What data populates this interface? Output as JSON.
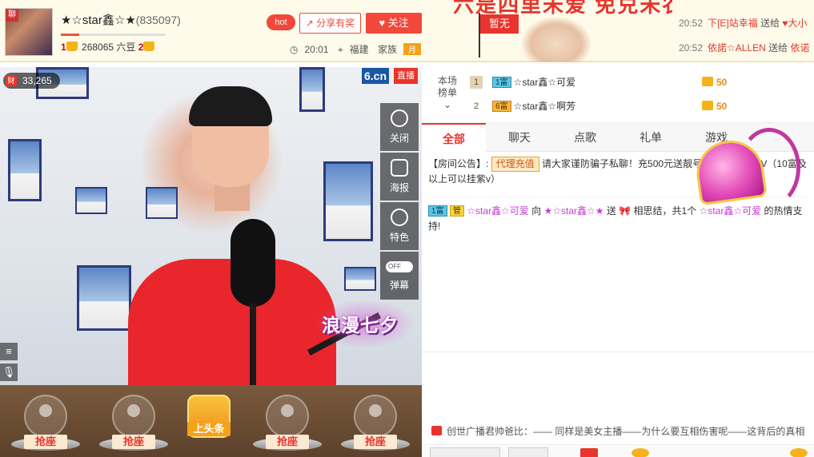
{
  "header": {
    "avatar_tag": "聊",
    "anchor_name": "★☆star鑫☆★",
    "anchor_id": "(835097)",
    "level_left": "1",
    "beans": "268065 六豆",
    "level_right": "2",
    "hot_label": "hot",
    "share_label": "分享有奖",
    "follow_label": "关注",
    "time": "20:01",
    "location": "福建",
    "family_label": "家族",
    "family_badge": "月"
  },
  "banner": {
    "text": "六是四里未爱 免兑未农",
    "flag": "暂无"
  },
  "feed": [
    {
      "time": "20:52",
      "user": "下[E]站幸福",
      "action": "送给",
      "target": "♥大小"
    },
    {
      "time": "20:52",
      "user": "依諾☆ALLEN",
      "action": "送给",
      "target": "依诺"
    }
  ],
  "video": {
    "viewers": "33,265",
    "viewer_icon": "财",
    "site_logo": "6.cn",
    "live_tag": "直播",
    "tools": [
      {
        "label": "关闭"
      },
      {
        "label": "海报"
      },
      {
        "label": "特色"
      },
      {
        "label": "弹幕",
        "toggle": "OFF"
      }
    ],
    "sticker": "浪漫七夕"
  },
  "seats": [
    {
      "label": "抢座"
    },
    {
      "label": "抢座"
    },
    {
      "label": "上头条"
    },
    {
      "label": "抢座"
    },
    {
      "label": "抢座"
    }
  ],
  "rank": {
    "label_line1": "本场",
    "label_line2": "榜单",
    "rows": [
      {
        "no": "1",
        "badge": "1富",
        "name": "☆star鑫☆可爱",
        "score": "50"
      },
      {
        "no": "2",
        "badge": "6富",
        "name": "☆star鑫☆啊芳",
        "score": "50"
      }
    ]
  },
  "tabs": [
    {
      "label": "全部"
    },
    {
      "label": "聊天"
    },
    {
      "label": "点歌"
    },
    {
      "label": "礼单"
    },
    {
      "label": "游戏"
    }
  ],
  "chat": {
    "notice_prefix": "【房间公告】:",
    "notice_agent": "代理充值",
    "notice_text": "请大家谨防骗子私聊！充500元送靓号，20元送挂紫V（10富及以上可以挂紫v）",
    "msg_badge": "1富",
    "msg_user": "☆star鑫☆可爱",
    "msg_mid": "向",
    "msg_target": "★☆star鑫☆★",
    "msg_action": "送",
    "msg_gift": "相思结，共1个",
    "msg_tail_user": "☆star鑫☆可爱",
    "msg_tail": "的热情支持!"
  },
  "ad": {
    "text": "创世广播君帅爸比：—— 同样是美女主播——为什么要互相伤害呢——这背后的真相"
  },
  "colors": {
    "accent": "#e8342c",
    "gold": "#f5b21b",
    "header_bg": "#fffbea"
  }
}
